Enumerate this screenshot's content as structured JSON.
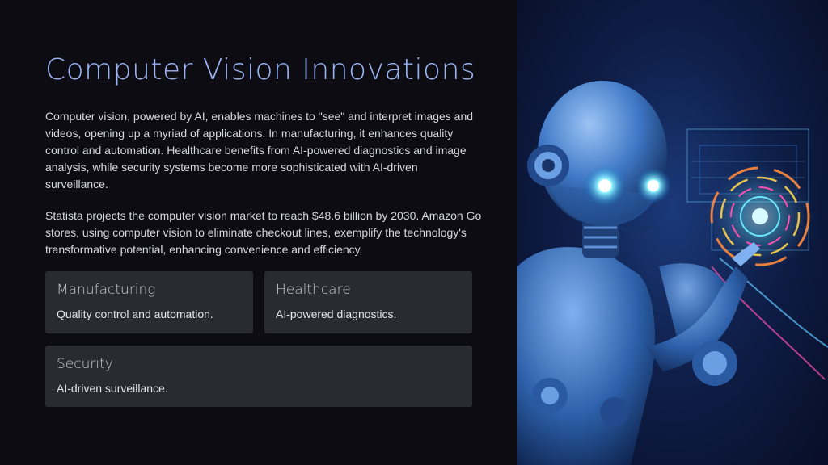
{
  "slide": {
    "title": "Computer Vision Innovations",
    "paragraphs": [
      "Computer vision, powered by AI, enables machines to \"see\" and interpret images and videos, opening up a myriad of applications. In manufacturing, it enhances quality control and automation. Healthcare benefits from AI-powered diagnostics and image analysis, while security systems become more sophisticated with AI-driven surveillance.",
      "Statista projects the computer vision market to reach $48.6 billion by 2030. Amazon Go stores, using computer vision to eliminate checkout lines, exemplify the technology's transformative potential, enhancing convenience and efficiency."
    ],
    "cards": [
      {
        "title": "Manufacturing",
        "desc": "Quality control and automation."
      },
      {
        "title": "Healthcare",
        "desc": "AI-powered diagnostics."
      },
      {
        "title": "Security",
        "desc": "AI-driven surveillance."
      }
    ]
  },
  "image": {
    "subject": "robot-hologram-illustration",
    "colors": {
      "background": "#0c0c12",
      "title": "#9ab4f3",
      "card": "#2a2a31",
      "robot": "#3f78c6",
      "eye_glow": "#5fe3ff"
    }
  }
}
